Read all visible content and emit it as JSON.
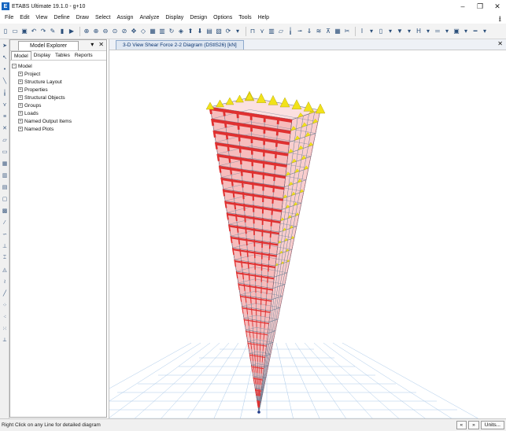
{
  "window": {
    "title": "ETABS Ultimate 19.1.0 - g+10",
    "logo_letter": "E",
    "minimize": "–",
    "restore": "❐",
    "close": "✕"
  },
  "menu": {
    "items": [
      "File",
      "Edit",
      "View",
      "Define",
      "Draw",
      "Select",
      "Assign",
      "Analyze",
      "Display",
      "Design",
      "Options",
      "Tools",
      "Help"
    ]
  },
  "explorer": {
    "title": "Model Explorer",
    "pin": "▾",
    "close": "✕",
    "tabs": [
      "Model",
      "Display",
      "Tables",
      "Reports"
    ],
    "root": "Model",
    "items": [
      "Project",
      "Structure Layout",
      "Properties",
      "Structural Objects",
      "Groups",
      "Loads",
      "Named Output Items",
      "Named Plots"
    ]
  },
  "view": {
    "tab_label": "3-D View   Shear Force 2-2 Diagram   (DStlS26)  [kN]",
    "close": "✕"
  },
  "status": {
    "text": "Right Click on any Line for detailed diagram",
    "buttons": [
      "«",
      "»",
      "Units..."
    ]
  },
  "colors": {
    "shear_red": "#e03030",
    "shear_pink": "#f4a6a6",
    "shear_yellow": "#f2e21a",
    "frame_grey": "#6b7f95",
    "grid_blue": "#a9c8e8",
    "accent": "#1565c0"
  }
}
